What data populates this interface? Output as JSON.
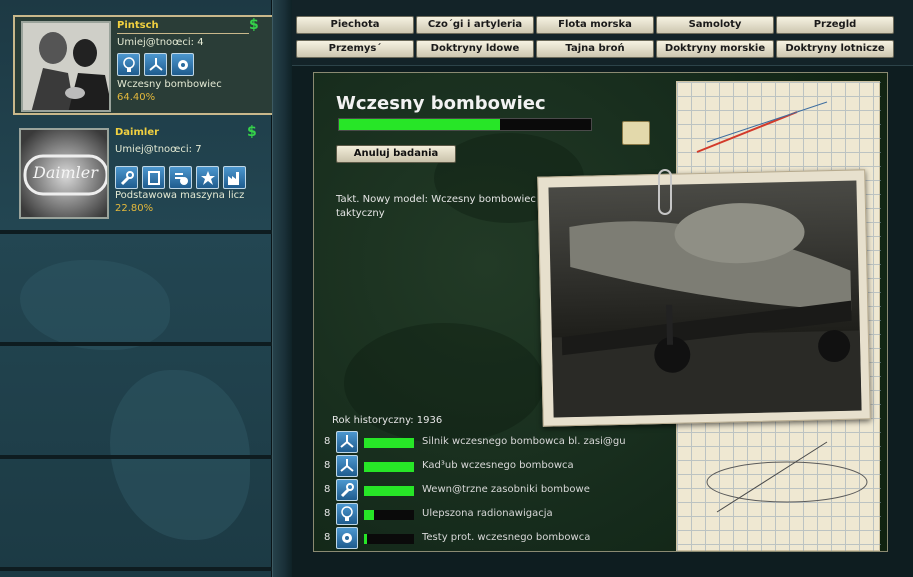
{
  "tabs": {
    "row1": [
      "Piechota",
      "Czo´gi i artyleria",
      "Flota morska",
      "Samoloty",
      "Przegld"
    ],
    "row2": [
      "Przemys´",
      "Doktryny ldowe",
      "Tajna broń",
      "Doktryny morskie",
      "Doktryny lotnicze"
    ]
  },
  "companies": [
    {
      "name": "Pintsch",
      "skill": "Umiej@tnoœci: 4",
      "project": "Wczesny bombowiec",
      "progress": "64.40%",
      "currency_icon": "$",
      "icons": [
        "lightbulb-icon",
        "propeller-icon",
        "gear-icon"
      ]
    },
    {
      "name": "Daimler",
      "skill": "Umiej@tnoœci: 7",
      "project": "Podstawowa maszyna licz",
      "progress": "22.80%",
      "currency_icon": "$",
      "icons": [
        "wrench-icon",
        "book-icon",
        "gear-list-icon",
        "star-icon",
        "factory-icon"
      ],
      "logo_text": "Daimler"
    }
  ],
  "detail": {
    "title": "Wczesny bombowiec",
    "progress": 0.64,
    "cancel_label": "Anuluj badania",
    "description": "Takt. Nowy model: Wczesny bombowiec taktyczny",
    "historical_year": "Rok historyczny: 1936",
    "components": [
      {
        "level": "8",
        "icon": "propeller-icon",
        "progress": 1.0,
        "name": "Silnik wczesnego bombowca bl. zasi@gu"
      },
      {
        "level": "8",
        "icon": "propeller-icon",
        "progress": 1.0,
        "name": "Kad³ub wczesnego bombowca"
      },
      {
        "level": "8",
        "icon": "wrench-icon",
        "progress": 1.0,
        "name": "Wewn@trzne zasobniki bombowe"
      },
      {
        "level": "8",
        "icon": "lightbulb-icon",
        "progress": 0.2,
        "name": "Ulepszona radionawigacja"
      },
      {
        "level": "8",
        "icon": "gear-icon",
        "progress": 0.05,
        "name": "Testy prot. wczesnego bombowca"
      }
    ]
  },
  "colors": {
    "accent_green": "#27e627",
    "name_gold": "#f0d040",
    "pct_orange": "#e3b83c"
  }
}
